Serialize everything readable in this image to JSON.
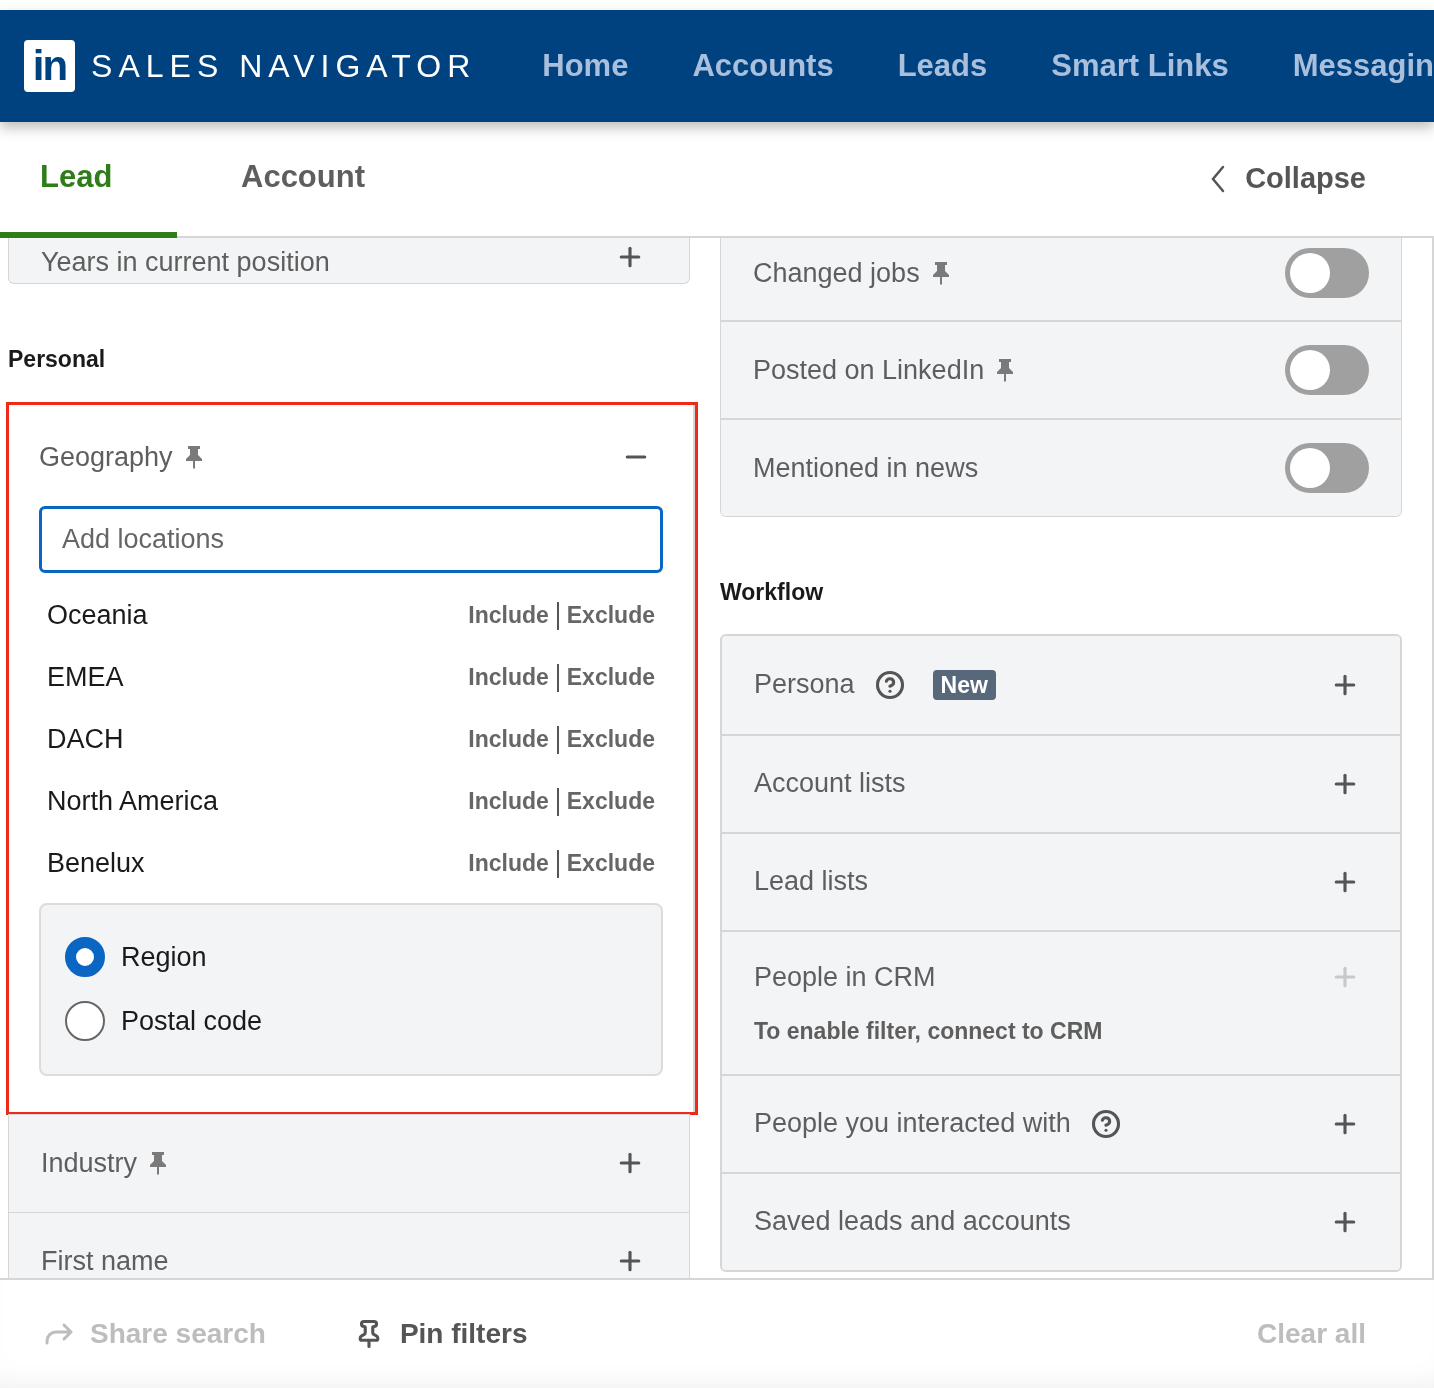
{
  "nav": {
    "logo": "in",
    "brand": "SALES NAVIGATOR",
    "links": [
      {
        "label": "Home"
      },
      {
        "label": "Accounts"
      },
      {
        "label": "Leads"
      },
      {
        "label": "Smart Links"
      },
      {
        "label": "Messagin"
      }
    ]
  },
  "tabs": [
    {
      "label": "Lead",
      "selected": true
    },
    {
      "label": "Account",
      "selected": false
    }
  ],
  "collapse": {
    "label": "Collapse"
  },
  "left_column": [
    {
      "kind": "filter",
      "label": "Years in current position",
      "pinned": false
    },
    {
      "kind": "heading",
      "label": "Personal"
    },
    {
      "kind": "geography",
      "label": "Geography",
      "pinned": true,
      "expanded": true,
      "highlighted": true,
      "placeholder": "Add locations",
      "suggestions": [
        {
          "name": "Oceania",
          "include": "Include",
          "exclude": "Exclude"
        },
        {
          "name": "EMEA",
          "include": "Include",
          "exclude": "Exclude"
        },
        {
          "name": "DACH",
          "include": "Include",
          "exclude": "Exclude"
        },
        {
          "name": "North America",
          "include": "Include",
          "exclude": "Exclude"
        },
        {
          "name": "Benelux",
          "include": "Include",
          "exclude": "Exclude"
        }
      ],
      "options": [
        {
          "label": "Region",
          "selected": true
        },
        {
          "label": "Postal code",
          "selected": false
        }
      ]
    },
    {
      "kind": "filter",
      "label": "Industry",
      "pinned": true
    },
    {
      "kind": "filter",
      "label": "First name",
      "pinned": false
    }
  ],
  "toggles": [
    {
      "label": "Changed jobs",
      "pinned": true,
      "on": false
    },
    {
      "label": "Posted on LinkedIn",
      "pinned": true,
      "on": false
    },
    {
      "label": "Mentioned in news",
      "pinned": false,
      "on": false
    }
  ],
  "workflow": {
    "heading": "Workflow",
    "items": [
      {
        "label": "Persona",
        "help": true,
        "badge": "New",
        "disabled": false
      },
      {
        "label": "Account lists",
        "help": false,
        "disabled": false
      },
      {
        "label": "Lead lists",
        "help": false,
        "disabled": false
      },
      {
        "label": "People in CRM",
        "help": false,
        "disabled": true,
        "note": "To enable filter, connect to CRM"
      },
      {
        "label": "People you interacted with",
        "help": true,
        "disabled": false
      },
      {
        "label": "Saved leads and accounts",
        "help": false,
        "disabled": false
      }
    ]
  },
  "footer": {
    "share": {
      "label": "Share search",
      "disabled": true
    },
    "pin": {
      "label": "Pin filters"
    },
    "clear": {
      "label": "Clear all",
      "disabled": true
    }
  }
}
